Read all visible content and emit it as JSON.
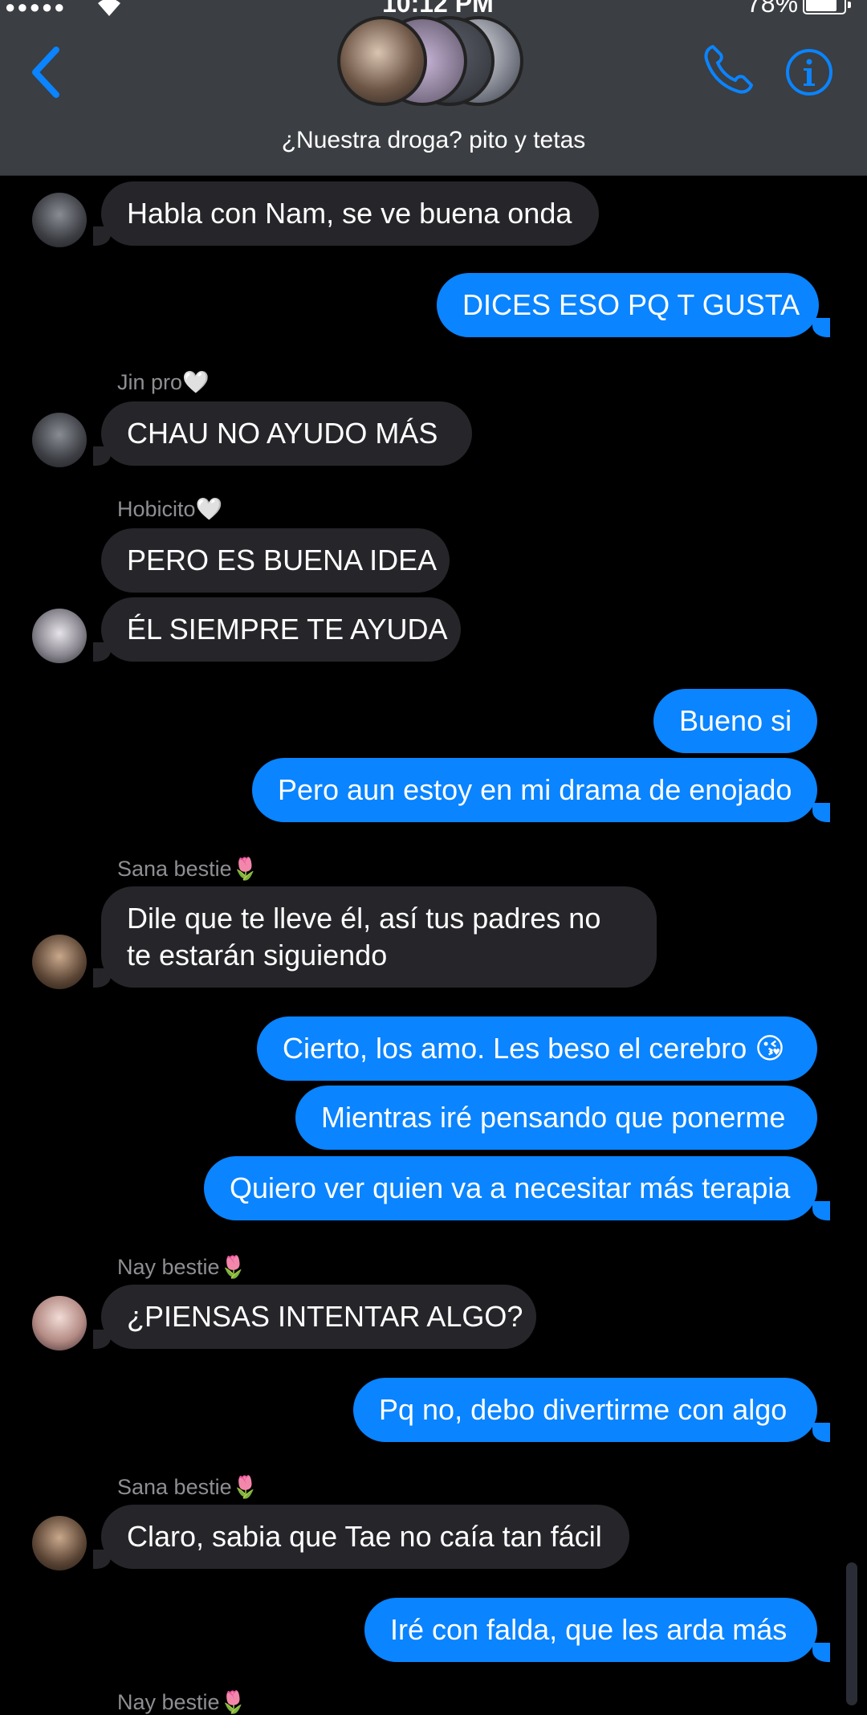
{
  "status_bar": {
    "signal": "●●●●●",
    "wifi": "wifi-icon",
    "time": "10:12 PM",
    "battery": "78%"
  },
  "header": {
    "group_name": "¿Nuestra droga? pito y tetas",
    "accent": "#0a84ff"
  },
  "messages": {
    "m1": "Habla con Nam, se ve buena onda",
    "m2": "DICES ESO PQ T GUSTA",
    "s3": "Jin pro🤍",
    "m3": "CHAU NO AYUDO MÁS",
    "s4": "Hobicito🤍",
    "m4": "PERO ES BUENA IDEA",
    "m5": "ÉL SIEMPRE TE AYUDA",
    "m6": "Bueno si",
    "m7": "Pero aun estoy en mi drama de enojado",
    "s8": "Sana bestie🌷",
    "m8": "Dile que te lleve él, así tus padres no te estarán siguiendo",
    "m9": "Cierto, los amo. Les beso el cerebro 😘",
    "m10": "Mientras iré pensando que ponerme",
    "m11": "Quiero ver quien va a necesitar más terapia",
    "s12": "Nay bestie🌷",
    "m12": "¿PIENSAS INTENTAR ALGO?",
    "m13": "Pq no, debo divertirme con algo",
    "s14": "Sana bestie🌷",
    "m14": "Claro, sabia que Tae no caía tan fácil",
    "m15": "Iré con falda, que les arda más",
    "s16": "Nay bestie🌷"
  },
  "colors": {
    "header_bg": "#3b3e42",
    "incoming_bubble": "#26252a",
    "outgoing_bubble": "#0a84ff",
    "sender_label": "#8e8e93"
  }
}
